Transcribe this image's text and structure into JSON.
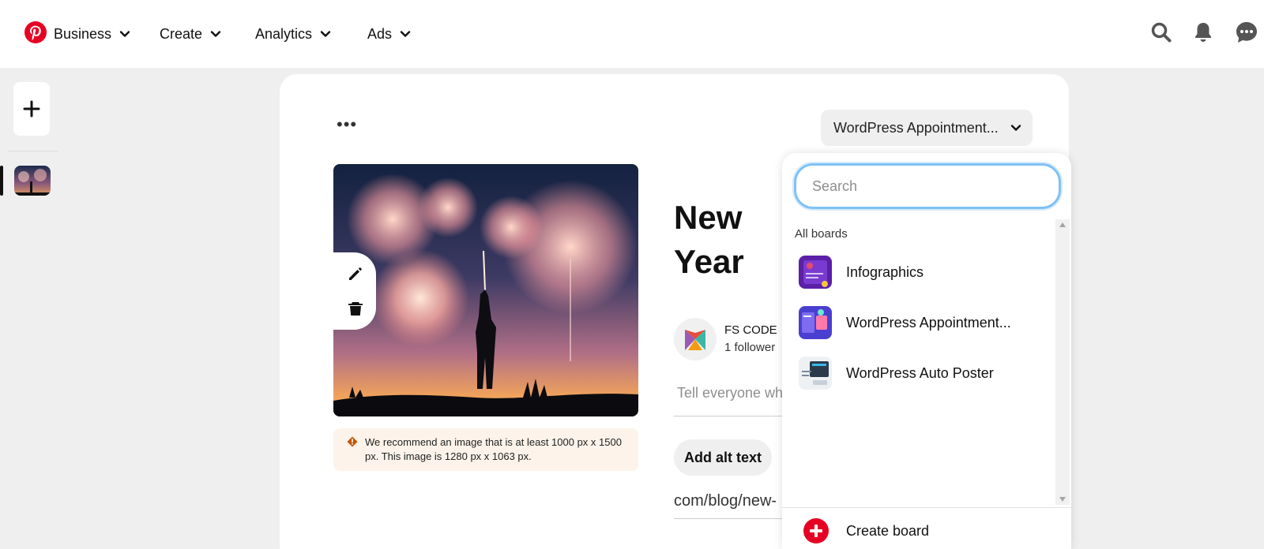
{
  "nav": {
    "logo": "pinterest-logo",
    "items": [
      {
        "label": "Business"
      },
      {
        "label": "Create"
      },
      {
        "label": "Analytics"
      },
      {
        "label": "Ads"
      }
    ],
    "icons": [
      "search-icon",
      "bell-icon",
      "messages-icon"
    ]
  },
  "rail": {
    "add_icon": "plus-icon",
    "thumb": "fireworks-thumbnail"
  },
  "editor": {
    "more_label": "•••",
    "board_selected": "WordPress Appointment...",
    "title": "New Year Media C",
    "account": {
      "name": "FS CODE",
      "followers": "1 follower"
    },
    "description_placeholder": "Tell everyone wh",
    "alt_button": "Add alt text",
    "link_value": "com/blog/new-",
    "warning": "We recommend an image that is at least 1000 px x 1500 px. This image is 1280 px x 1063 px."
  },
  "dropdown": {
    "search_placeholder": "Search",
    "section_label": "All boards",
    "boards": [
      {
        "label": "Infographics"
      },
      {
        "label": "WordPress Appointment..."
      },
      {
        "label": "WordPress Auto Poster"
      }
    ],
    "create_label": "Create board"
  },
  "colors": {
    "brand": "#e60023",
    "focus": "#7fc1f7",
    "warning_bg": "#fdf3ea",
    "warning_icon": "#c45500"
  }
}
